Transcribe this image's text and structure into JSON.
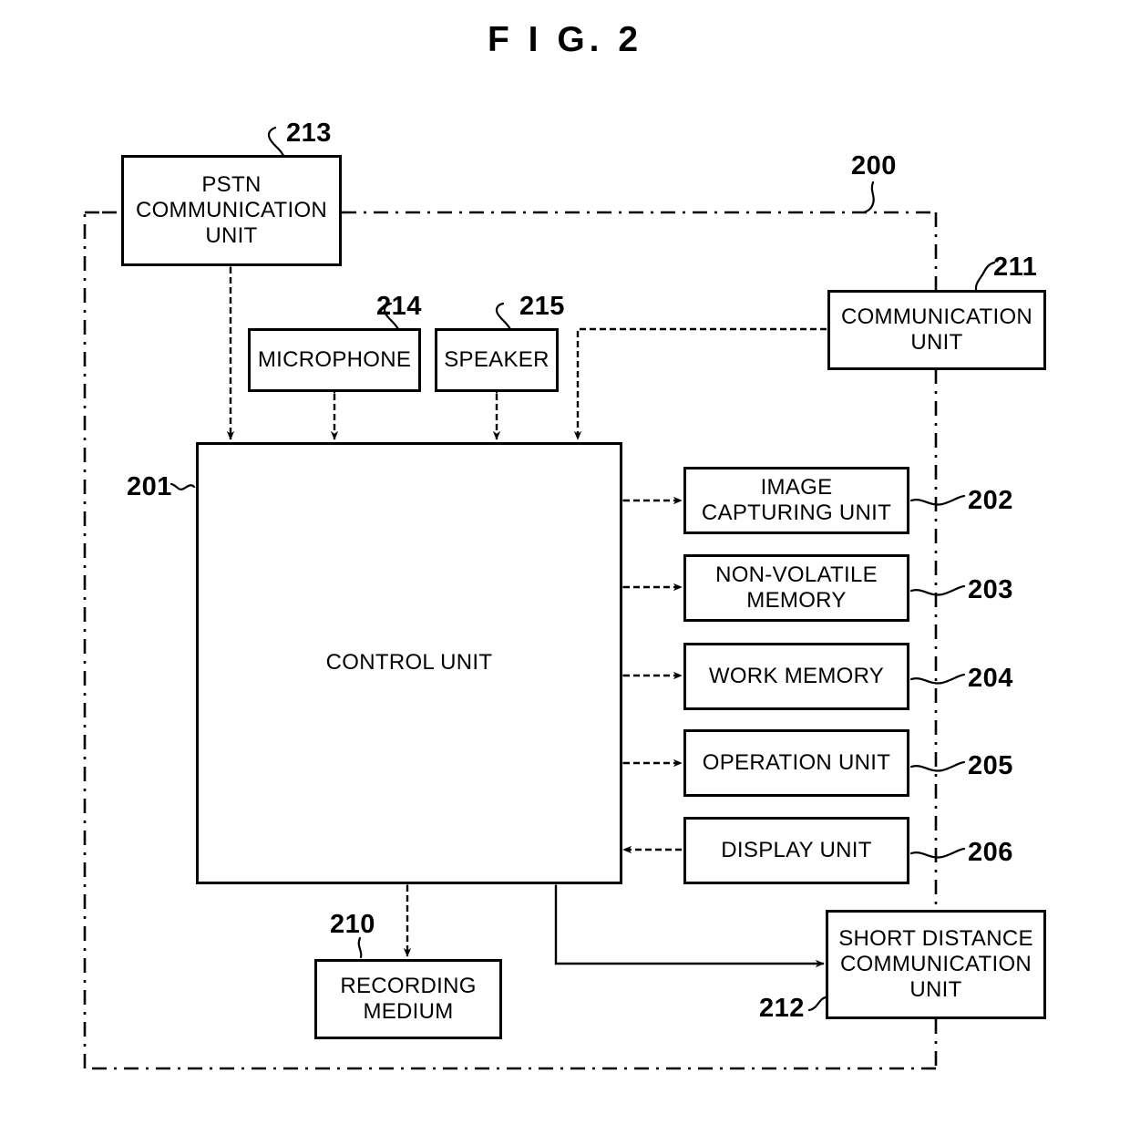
{
  "figure": {
    "title": "F I G.  2"
  },
  "system_boundary": {
    "ref": "200",
    "style": "dash-dot"
  },
  "blocks": [
    {
      "id": "pstn",
      "label": "PSTN\nCOMMUNICATION\nUNIT",
      "ref": "213"
    },
    {
      "id": "microphone",
      "label": "MICROPHONE",
      "ref": "214"
    },
    {
      "id": "speaker",
      "label": "SPEAKER",
      "ref": "215"
    },
    {
      "id": "comm",
      "label": "COMMUNICATION\nUNIT",
      "ref": "211"
    },
    {
      "id": "control",
      "label": "CONTROL UNIT",
      "ref": "201"
    },
    {
      "id": "image",
      "label": "IMAGE\nCAPTURING UNIT",
      "ref": "202"
    },
    {
      "id": "nvmem",
      "label": "NON-VOLATILE\nMEMORY",
      "ref": "203"
    },
    {
      "id": "workmem",
      "label": "WORK MEMORY",
      "ref": "204"
    },
    {
      "id": "operation",
      "label": "OPERATION UNIT",
      "ref": "205"
    },
    {
      "id": "display",
      "label": "DISPLAY UNIT",
      "ref": "206"
    },
    {
      "id": "recording",
      "label": "RECORDING\nMEDIUM",
      "ref": "210"
    },
    {
      "id": "shortdist",
      "label": "SHORT DISTANCE\nCOMMUNICATION\nUNIT",
      "ref": "212"
    }
  ],
  "labels": {
    "pstn": "PSTN\nCOMMUNICATION\nUNIT",
    "microphone": "MICROPHONE",
    "speaker": "SPEAKER",
    "comm": "COMMUNICATION\nUNIT",
    "control": "CONTROL UNIT",
    "image": "IMAGE\nCAPTURING UNIT",
    "nvmem": "NON-VOLATILE\nMEMORY",
    "workmem": "WORK MEMORY",
    "operation": "OPERATION UNIT",
    "display": "DISPLAY UNIT",
    "recording": "RECORDING\nMEDIUM",
    "shortdist": "SHORT DISTANCE\nCOMMUNICATION\nUNIT"
  },
  "refs": {
    "system": "200",
    "control": "201",
    "image": "202",
    "nvmem": "203",
    "workmem": "204",
    "operation": "205",
    "display": "206",
    "recording": "210",
    "comm": "211",
    "shortdist": "212",
    "pstn": "213",
    "microphone": "214",
    "speaker": "215"
  },
  "connections": [
    {
      "from": "pstn",
      "to": "control",
      "arrow": "both"
    },
    {
      "from": "microphone",
      "to": "control",
      "arrow": "both"
    },
    {
      "from": "speaker",
      "to": "control",
      "arrow": "both"
    },
    {
      "from": "comm",
      "to": "control",
      "arrow": "to-control"
    },
    {
      "from": "control",
      "to": "image",
      "arrow": "both"
    },
    {
      "from": "control",
      "to": "nvmem",
      "arrow": "both"
    },
    {
      "from": "control",
      "to": "workmem",
      "arrow": "both"
    },
    {
      "from": "control",
      "to": "operation",
      "arrow": "both"
    },
    {
      "from": "display",
      "to": "control",
      "arrow": "to-control"
    },
    {
      "from": "control",
      "to": "recording",
      "arrow": "both"
    },
    {
      "from": "control",
      "to": "shortdist",
      "arrow": "to-shortdist"
    }
  ],
  "colors": {
    "line": "#000000",
    "background": "#ffffff"
  }
}
